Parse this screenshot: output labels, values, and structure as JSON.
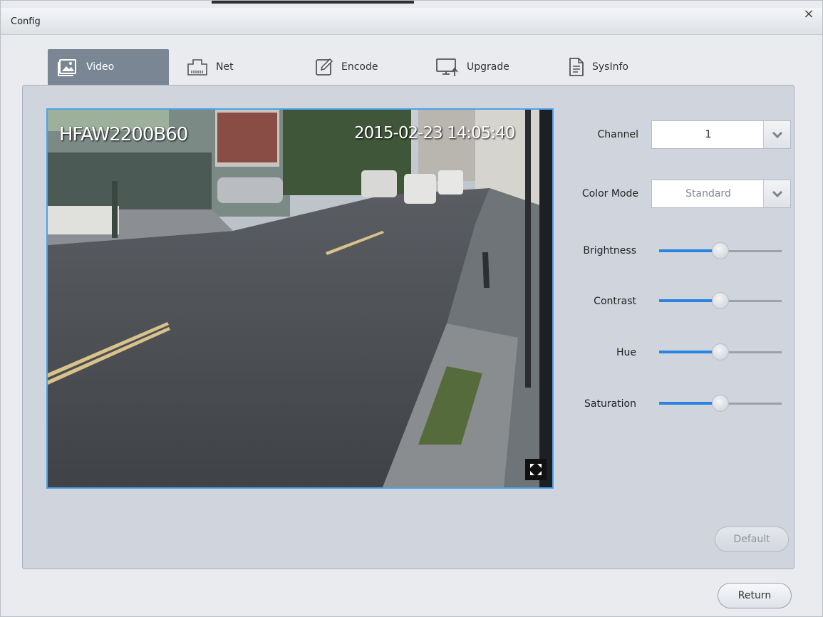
{
  "window": {
    "title": "Config",
    "close_glyph": "×"
  },
  "tabs": [
    {
      "label": "Video",
      "icon": "image-icon",
      "active": true
    },
    {
      "label": "Net",
      "icon": "network-icon",
      "active": false
    },
    {
      "label": "Encode",
      "icon": "edit-icon",
      "active": false
    },
    {
      "label": "Upgrade",
      "icon": "monitor-upload-icon",
      "active": false
    },
    {
      "label": "SysInfo",
      "icon": "document-icon",
      "active": false
    }
  ],
  "video": {
    "osd_name": "HFAW2200B60",
    "osd_time": "2015-02-23 14:05:40",
    "fullscreen_icon": "fullscreen-icon"
  },
  "controls": {
    "channel": {
      "label": "Channel",
      "value": "1"
    },
    "color_mode": {
      "label": "Color Mode",
      "value": "Standard"
    },
    "sliders": [
      {
        "label": "Brightness",
        "value_pct": 50
      },
      {
        "label": "Contrast",
        "value_pct": 50
      },
      {
        "label": "Hue",
        "value_pct": 50
      },
      {
        "label": "Saturation",
        "value_pct": 50
      }
    ]
  },
  "buttons": {
    "default_label": "Default",
    "return_label": "Return"
  },
  "colors": {
    "accent": "#2a83e0",
    "active_tab": "#7b8694",
    "video_border": "#4aa3ea"
  }
}
